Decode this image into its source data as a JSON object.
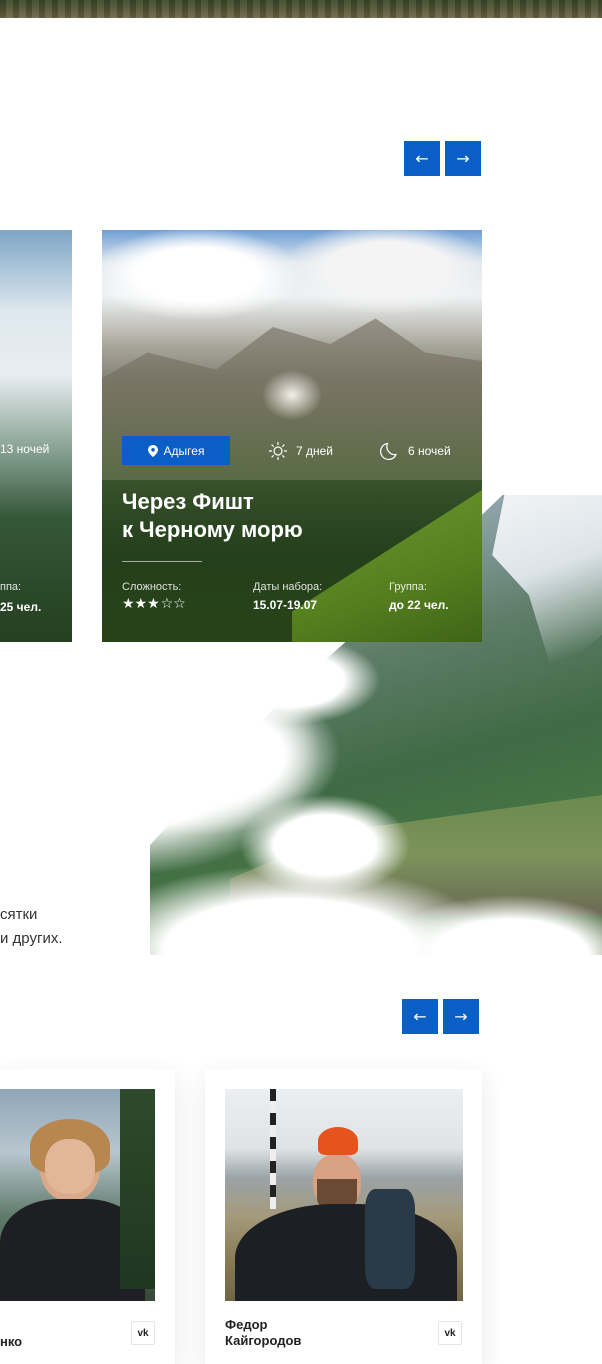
{
  "tours": {
    "nav": {
      "prev": "←",
      "next": "→"
    },
    "left_card": {
      "nights": "13 ночей",
      "group_label": "ппа:",
      "group_value": "25 чел."
    },
    "main_card": {
      "region": "Адыгея",
      "days": "7 дней",
      "nights": "6 ночей",
      "title": "Через Фишт\nк Черному морю",
      "difficulty_label": "Сложность:",
      "difficulty": {
        "rating": 3,
        "max": 5,
        "filled": "★★★",
        "empty": "☆☆"
      },
      "dates_label": "Даты набора:",
      "dates_value": "15.07-19.07",
      "group_label": "Группа:",
      "group_value": "до 22 чел."
    }
  },
  "about": {
    "text": "сятки\n и других."
  },
  "guides": {
    "nav": {
      "prev": "←",
      "next": "→"
    },
    "items": [
      {
        "name": "нко",
        "social": "vk"
      },
      {
        "name": "Федор\nКайгородов",
        "social": "vk"
      }
    ]
  },
  "colors": {
    "accent": "#0a5fc6"
  }
}
